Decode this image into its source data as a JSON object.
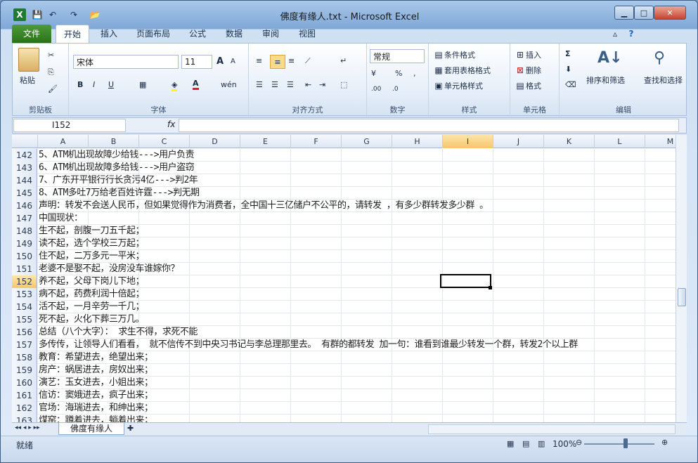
{
  "window": {
    "title": "佛度有缘人.txt  -  Microsoft Excel",
    "minimize": "▁",
    "maximize": "□",
    "close": "✕"
  },
  "quick_access": {
    "app_icon": "excel-icon",
    "save": "💾",
    "undo": "↶",
    "redo": "↷",
    "open": "📂"
  },
  "ribbon_tabs": [
    "文件",
    "开始",
    "插入",
    "页面布局",
    "公式",
    "数据",
    "审阅",
    "视图"
  ],
  "ribbon": {
    "clipboard": {
      "paste": "粘贴",
      "label": "剪贴板"
    },
    "font": {
      "name": "宋体",
      "size": "11",
      "label": "字体",
      "bold": "B",
      "italic": "I",
      "underline": "U",
      "grow": "A",
      "shrink": "A",
      "phonetic": "wén"
    },
    "alignment": {
      "label": "对齐方式"
    },
    "number": {
      "format": "常规",
      "percent": "%",
      "comma": ",",
      "inc_dec": ".00",
      "dec_dec": ".0",
      "label": "数字"
    },
    "styles": {
      "conditional": "条件格式",
      "table": "套用表格格式",
      "cell": "单元格样式",
      "label": "样式"
    },
    "cells": {
      "insert": "插入",
      "delete": "删除",
      "format": "格式",
      "label": "单元格"
    },
    "editing": {
      "sum": "Σ",
      "sort": "排序和筛选",
      "find": "查找和选择",
      "label": "编辑"
    }
  },
  "formula_bar": {
    "name_box": "I152",
    "fx": "fx",
    "value": ""
  },
  "columns": [
    "A",
    "B",
    "C",
    "D",
    "E",
    "F",
    "G",
    "H",
    "I",
    "J",
    "K",
    "L",
    "M"
  ],
  "selected_column": "I",
  "rows": [
    {
      "n": "142",
      "t": "5、ATM机出现故障少给钱--->用户负责"
    },
    {
      "n": "143",
      "t": "6、ATM机出现故障多给钱--->用户盗窃"
    },
    {
      "n": "144",
      "t": "7、广东开平银行行长贪污4亿--->判2年"
    },
    {
      "n": "145",
      "t": "8、ATM多吐7万给老百姓许霆--->判无期"
    },
    {
      "n": "146",
      "t": "声明：转发不会送人民币，但如果觉得作为消费者，全中国十三亿储户不公平的，请转发 ，有多少群转发多少群 。"
    },
    {
      "n": "147",
      "t": "中国现状："
    },
    {
      "n": "148",
      "t": "生不起，剖腹一刀五千起；"
    },
    {
      "n": "149",
      "t": "读不起，选个学校三万起；"
    },
    {
      "n": "150",
      "t": "住不起，二万多元一平米；"
    },
    {
      "n": "151",
      "t": "老婆不是娶不起，没房没车谁嫁你？"
    },
    {
      "n": "152",
      "t": "养不起，父母下岗儿下地；"
    },
    {
      "n": "153",
      "t": "病不起，药费利润十倍起；"
    },
    {
      "n": "154",
      "t": "活不起，一月辛劳一千几；"
    },
    {
      "n": "155",
      "t": "死不起，火化下葬三万几。"
    },
    {
      "n": "156",
      "t": "总结（八个大字）： 求生不得，求死不能"
    },
    {
      "n": "157",
      "t": "多传传，让领导人们看看， 就不信传不到中央习书记与李总理那里去。 有群的都转发 加一句：谁看到谁最少转发一个群，转发2个以上群"
    },
    {
      "n": "158",
      "t": "教育：希望进去，绝望出来；"
    },
    {
      "n": "159",
      "t": "房产：蜗居进去，房奴出来；"
    },
    {
      "n": "160",
      "t": "演艺：玉女进去，小姐出来；"
    },
    {
      "n": "161",
      "t": "信访：窦娥进去，疯子出来；"
    },
    {
      "n": "162",
      "t": "官场：海瑞进去，和绅出来；"
    },
    {
      "n": "163",
      "t": "煤窑：蹲着进去，躺着出来；"
    }
  ],
  "selected_row": "152",
  "sheet_tab": "佛度有缘人",
  "status": {
    "ready": "就绪",
    "zoom": "100%",
    "zoom_level": 1.0
  }
}
